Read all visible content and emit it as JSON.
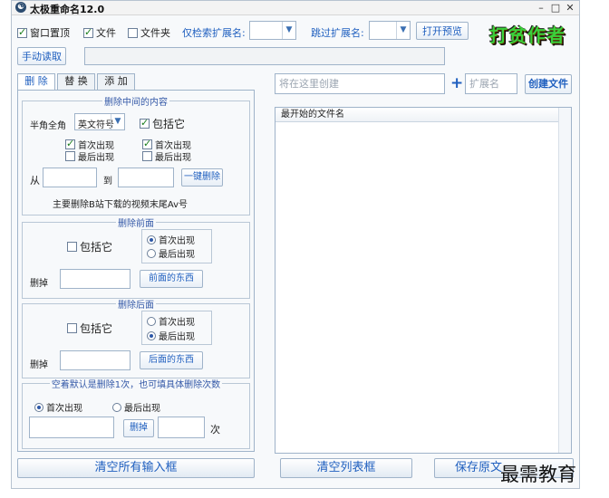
{
  "window": {
    "title": "太极重命名12.0",
    "minimize": "–",
    "maximize": "□",
    "close": "✕"
  },
  "toolbar": {
    "topmost": "窗口置顶",
    "file": "文件",
    "folder": "文件夹",
    "only_ext_label": "仅检索扩展名:",
    "skip_ext_label": "跳过扩展名:",
    "open_preview": "打开预览",
    "manual_read": "手动读取",
    "logo_text": "打贫作者"
  },
  "tabs": [
    "删 除",
    "替 换",
    "添 加"
  ],
  "delete_middle": {
    "title": "删除中间的内容",
    "width_label": "半角全角",
    "width_value": "英文符号",
    "include": "包括它",
    "left_first": "首次出现",
    "left_last": "最后出现",
    "right_first": "首次出现",
    "right_last": "最后出现",
    "from": "从",
    "to": "到",
    "one_key_delete": "一键删除",
    "note": "主要删除B站下载的视频末尾Av号"
  },
  "delete_front": {
    "title": "删除前面",
    "include": "包括它",
    "first": "首次出现",
    "last": "最后出现",
    "delete_label": "删掉",
    "button": "前面的东西"
  },
  "delete_back": {
    "title": "删除后面",
    "include": "包括它",
    "first": "首次出现",
    "last": "最后出现",
    "delete_label": "删掉",
    "button": "后面的东西"
  },
  "delete_count": {
    "title": "空着默认是删除1次，也可填具体删除次数",
    "first": "首次出现",
    "last": "最后出现",
    "button": "删掉",
    "unit": "次"
  },
  "right": {
    "create_placeholder": "将在这里创建",
    "plus": "+",
    "ext_placeholder": "扩展名",
    "create_file": "创建文件",
    "list_header": "最开始的文件名"
  },
  "bottom": {
    "clear_inputs": "清空所有输入框",
    "clear_list": "清空列表框",
    "save_original": "保存原文"
  },
  "watermark": "最需教育",
  "colors": {
    "accent": "#1f5fbf",
    "border": "#9fb3c9",
    "background": "#f7f9fb"
  }
}
